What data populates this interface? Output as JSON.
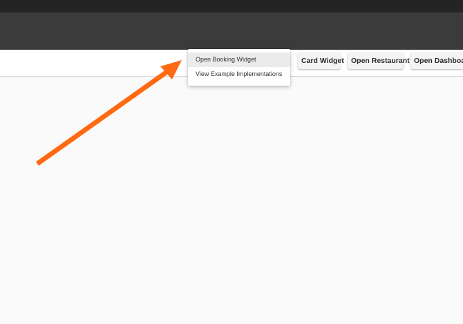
{
  "toolbar": {
    "buttons": [
      {
        "label": "Card Widget"
      },
      {
        "label": "Open Restaurant"
      },
      {
        "label": "Open Dashboard"
      }
    ]
  },
  "dropdown_menu": {
    "items": [
      {
        "label": "Open Booking Widget",
        "highlighted": true
      },
      {
        "label": "View Example Implementations",
        "highlighted": false
      }
    ]
  },
  "annotation": {
    "arrow_color": "#ff6a13"
  }
}
